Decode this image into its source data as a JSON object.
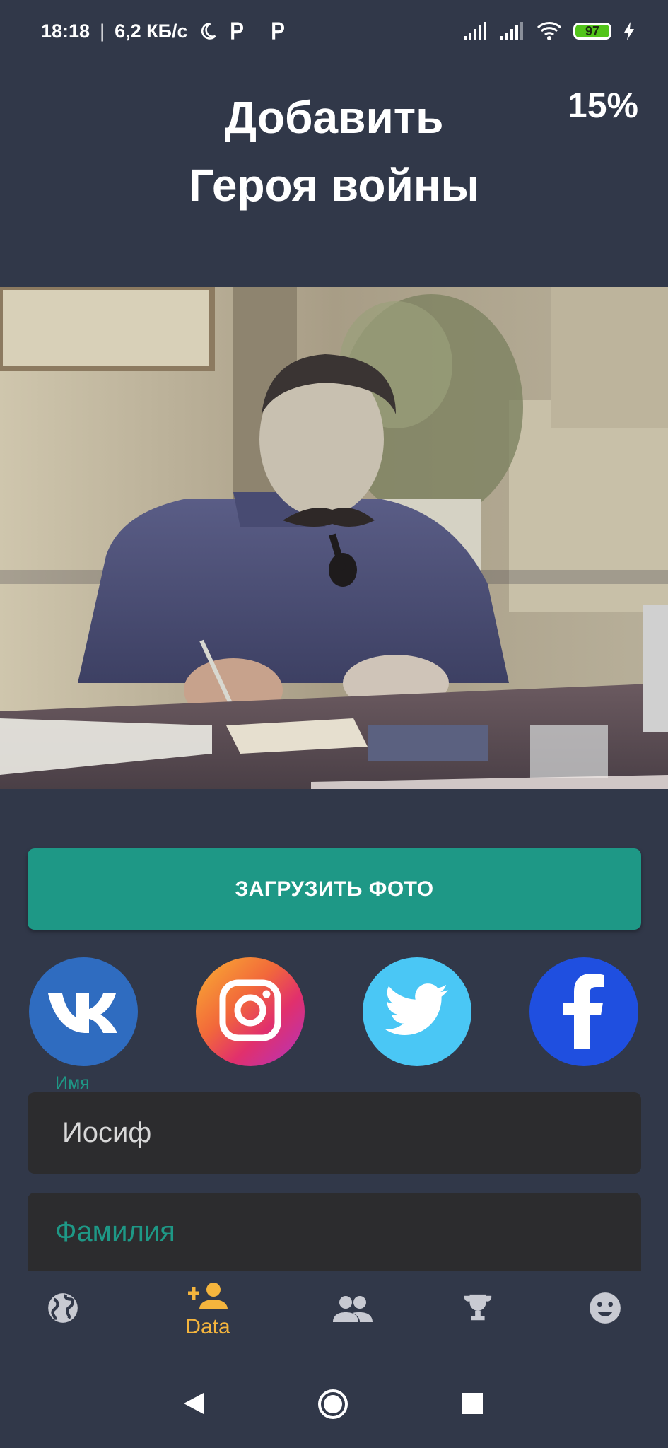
{
  "status_bar": {
    "time": "18:18",
    "separator": "|",
    "speed": "6,2 КБ/с",
    "battery_level": "97",
    "icons": [
      "moon-icon",
      "parking-icon",
      "parking-icon",
      "signal-icon",
      "signal-icon",
      "wifi-icon",
      "battery-icon",
      "charging-icon"
    ]
  },
  "header": {
    "title_line1": "Добавить",
    "title_line2": "Героя войны",
    "progress": "15%"
  },
  "photo": {
    "alt_icon": "portrait-photo"
  },
  "upload": {
    "label": "ЗАГРУЗИТЬ ФОТО",
    "color": "#1e9886"
  },
  "social": {
    "items": [
      {
        "name": "vk",
        "icon": "vk-icon",
        "color": "#2f6cc0"
      },
      {
        "name": "instagram",
        "icon": "instagram-icon",
        "color": "#e1306c"
      },
      {
        "name": "twitter",
        "icon": "twitter-icon",
        "color": "#4ac7f5"
      },
      {
        "name": "facebook",
        "icon": "facebook-icon",
        "color": "#1f4fe0"
      }
    ]
  },
  "form": {
    "first_name_label": "Имя",
    "first_name_value": "Иосиф",
    "last_name_placeholder": "Фамилия"
  },
  "bottom_nav": {
    "active_label": "Data",
    "active_color": "#f5b53d",
    "icons": [
      "globe-icon",
      "add-person-icon",
      "people-icon",
      "trophy-icon",
      "smiley-icon"
    ]
  },
  "system_nav": {
    "icons": [
      "back-icon",
      "home-icon",
      "recents-icon"
    ]
  }
}
